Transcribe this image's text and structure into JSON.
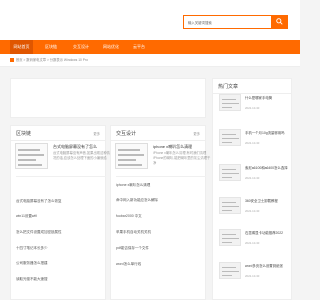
{
  "header": {
    "search_placeholder": "输入关键词搜索",
    "accent_color": "#ff6a00",
    "search_icon": "search-icon"
  },
  "nav": {
    "items": [
      {
        "label": "网站首页",
        "active": true
      },
      {
        "label": "区块链",
        "active": false
      },
      {
        "label": "交互设计",
        "active": false
      },
      {
        "label": "网站优化",
        "active": false
      },
      {
        "label": "云平台",
        "active": false
      }
    ]
  },
  "breadcrumb": {
    "text": "首页 > 数码家电文章 > 分数表示 Windows 10 Pro"
  },
  "hot": {
    "title": "热门文章",
    "items": [
      {
        "title": "什么是哪家手电筒",
        "date": "2022-10-30"
      },
      {
        "title": "手机一个月10g流量够用吗",
        "date": "2022-10-30"
      },
      {
        "title": "索尼a6100和a6400怎么选择",
        "date": "2022-10-30"
      },
      {
        "title": "360安全卫士卸载教程",
        "date": "2022-10-30"
      },
      {
        "title": "石墨烯显卡功能推荐2022",
        "date": "2022-10-30"
      },
      {
        "title": "word多页怎么设置到纸张",
        "date": "2022-10-30"
      }
    ]
  },
  "col1": {
    "title": "区块链",
    "more": "更多",
    "feature": {
      "title": "台式电脑屏幕没有了怎么",
      "desc": "台式电脑屏幕没有声音,如果出现这种情况的话,应该怎么处理下面的小编就给"
    },
    "items": [
      "台式电脑屏幕没有了怎么恢复",
      "win11设置wifi",
      "怎么把文件设置成加密锁属性",
      "十四寸笔记本长多少",
      "公司服务器怎么搭建",
      "读取光驱不能大速搜"
    ]
  },
  "col2": {
    "title": "交互设计",
    "more": "更多",
    "feature": {
      "title": "iphone x喇叭怎么清理",
      "desc": "iPhone x喇叭怎么清理,有时我们清理iPhone的喇叭,能把喇叭里的灰尘清理干净"
    },
    "items": [
      "iphone x喇叭怎么清理",
      "命中网入新功能应怎么解除",
      "foobar2000 中文",
      "苹果手机自动关机关机",
      "pdf能否保存一个文件",
      "word怎么单行线"
    ]
  }
}
